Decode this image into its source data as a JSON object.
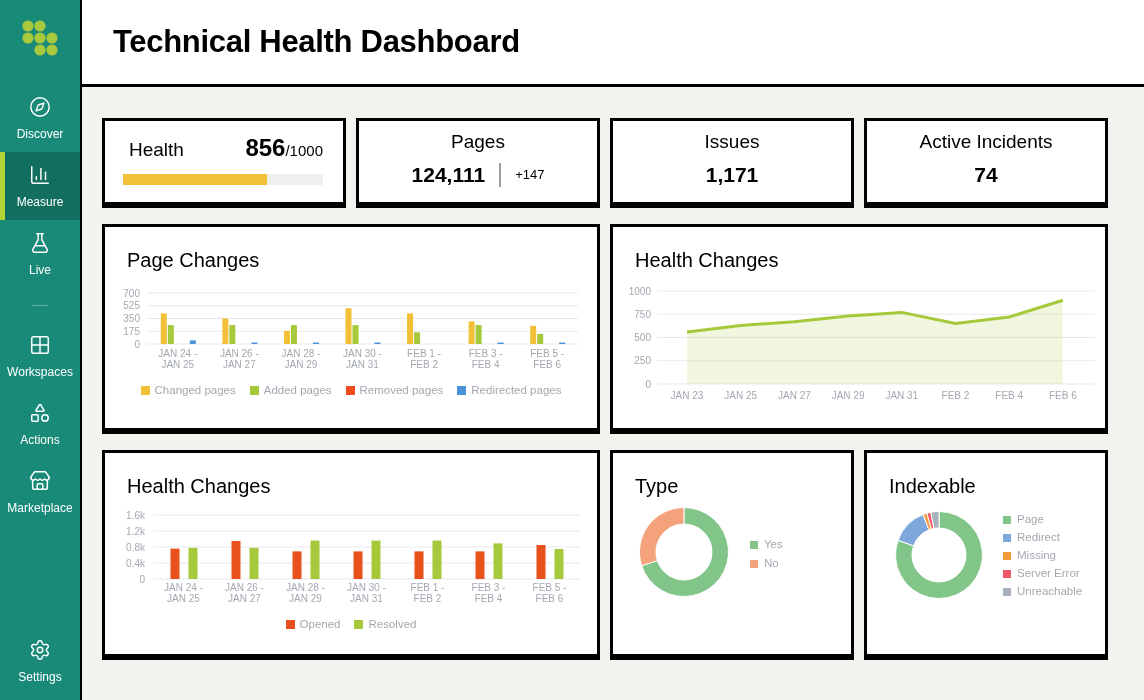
{
  "sidebar": {
    "primary_items": [
      {
        "label": "Discover",
        "selected": false
      },
      {
        "label": "Measure",
        "selected": true
      },
      {
        "label": "Live",
        "selected": false
      }
    ],
    "secondary_items": [
      {
        "label": "Workspaces",
        "selected": false
      },
      {
        "label": "Actions",
        "selected": false
      },
      {
        "label": "Marketplace",
        "selected": false
      }
    ],
    "footer_items": [
      {
        "label": "Settings",
        "selected": false
      }
    ]
  },
  "header": {
    "title": "Technical Health Dashboard"
  },
  "stats": [
    {
      "kind": "score",
      "label": "Health",
      "value": "856",
      "total": "/1000",
      "level": 0.72
    },
    {
      "kind": "count_delta",
      "label": "Pages",
      "value": "124,111",
      "delta": "+147"
    },
    {
      "kind": "count",
      "label": "Issues",
      "value": "1,171"
    },
    {
      "kind": "count",
      "label": "Active Incidents",
      "value": "74"
    }
  ],
  "page_changes": {
    "title": "Page Changes",
    "chart_data": {
      "type": "bar",
      "categories": [
        "JAN 24 - JAN 25",
        "JAN 26 - JAN 27",
        "JAN 28 - JAN 29",
        "JAN 30 - JAN 31",
        "FEB 1 - FEB 2",
        "FEB 3 - FEB 4",
        "FEB 5 - FEB 6"
      ],
      "series": [
        {
          "name": "Changed pages",
          "color": "#f2c037",
          "values": [
            420,
            350,
            180,
            490,
            420,
            310,
            250
          ]
        },
        {
          "name": "Added pages",
          "color": "#a6c93b",
          "values": [
            260,
            260,
            260,
            260,
            160,
            260,
            140
          ]
        },
        {
          "name": "Removed pages",
          "color": "#ef4b1f",
          "values": [
            0,
            0,
            0,
            0,
            0,
            0,
            0
          ]
        },
        {
          "name": "Redirected pages",
          "color": "#4a93d8",
          "values": [
            50,
            20,
            20,
            20,
            0,
            20,
            20
          ]
        }
      ],
      "ylim": [
        0,
        700
      ],
      "yticks": [
        0,
        175,
        350,
        525,
        700
      ],
      "grid": true,
      "legend": "bottom"
    }
  },
  "health_trend": {
    "title": "Health Changes",
    "chart_data": {
      "type": "area",
      "categories": [
        "JAN 23",
        "JAN 25",
        "JAN 27",
        "JAN 29",
        "JAN 31",
        "FEB 2",
        "FEB 4",
        "FEB 6"
      ],
      "series": [
        {
          "color": "#a6c93b",
          "values": [
            560,
            630,
            670,
            730,
            770,
            650,
            720,
            900
          ]
        }
      ],
      "ylim": [
        0,
        1000
      ],
      "yticks": [
        0,
        250,
        500,
        750,
        1000
      ],
      "grid": true
    }
  },
  "incident_changes": {
    "title": "Health Changes",
    "chart_data": {
      "type": "bar",
      "categories": [
        "JAN 24 - JAN 25",
        "JAN 26 - JAN 27",
        "JAN 28 - JAN 29",
        "JAN 30 - JAN 31",
        "FEB 1 - FEB 2",
        "FEB 3 - FEB 4",
        "FEB 5 - FEB 6"
      ],
      "series": [
        {
          "name": "Opened",
          "color": "#e8501c",
          "values": [
            760,
            950,
            690,
            690,
            690,
            690,
            850
          ]
        },
        {
          "name": "Resolved",
          "color": "#a6c93b",
          "values": [
            780,
            780,
            960,
            960,
            960,
            890,
            750
          ]
        }
      ],
      "ylim": [
        0,
        1600
      ],
      "yticks": [
        {
          "value": 0,
          "label": "0"
        },
        {
          "value": 400,
          "label": "0.4k"
        },
        {
          "value": 800,
          "label": "0.8k"
        },
        {
          "value": 1200,
          "label": "1.2k"
        },
        {
          "value": 1600,
          "label": "1.6k"
        }
      ],
      "grid": true,
      "legend": "bottom"
    }
  },
  "type_breakdown": {
    "title": "Type",
    "chart_data": {
      "type": "donut",
      "categories": [
        "Yes",
        "No"
      ],
      "values": [
        70,
        30
      ],
      "colors": [
        "#81c589",
        "#f4a27b"
      ],
      "legend": "right"
    }
  },
  "indexable_breakdown": {
    "title": "Indexable",
    "chart_data": {
      "type": "donut",
      "categories": [
        "Page",
        "Redirect",
        "Missing",
        "Server Error",
        "Unreachable"
      ],
      "values": [
        80.5,
        13.5,
        1.5,
        1.5,
        3
      ],
      "colors": [
        "#81c589",
        "#7ea7dc",
        "#f59a3c",
        "#ef5a6a",
        "#a8b0bb"
      ],
      "legend": "right"
    }
  }
}
